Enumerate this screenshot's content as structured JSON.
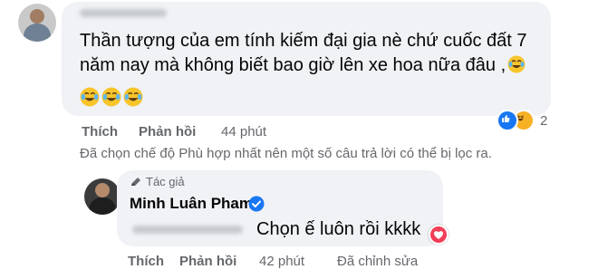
{
  "comment1": {
    "text": "Thần tượng của em tính kiếm đại gia nè chứ cuốc đất 7 năm nay mà không biết bao giờ lên xe hoa nữa đâu ,",
    "emoji_icons": [
      "tears-of-joy-emoji",
      "tears-of-joy-emoji",
      "tears-of-joy-emoji",
      "tears-of-joy-emoji"
    ],
    "actions": {
      "like": "Thích",
      "reply": "Phản hồi",
      "time": "44 phút"
    },
    "reactions": {
      "icons": [
        "like-icon",
        "haha-icon"
      ],
      "count": "2"
    }
  },
  "notice": "Đã chọn chế độ Phù hợp nhất nên một số câu trả lời có thể bị lọc ra.",
  "reply": {
    "badge": "Tác giả",
    "author": "Minh Luân Pham",
    "text": "Chọn ế luôn rồi kkkk",
    "reaction_icon": "love-icon",
    "actions": {
      "like": "Thích",
      "reply": "Phản hồi",
      "time": "42 phút",
      "edited": "Đã chỉnh sửa"
    }
  },
  "colors": {
    "bubble": "#f0f2f5",
    "meta": "#65676b",
    "accent": "#1877f2",
    "love": "#f33e58",
    "haha": "#f7b125"
  }
}
